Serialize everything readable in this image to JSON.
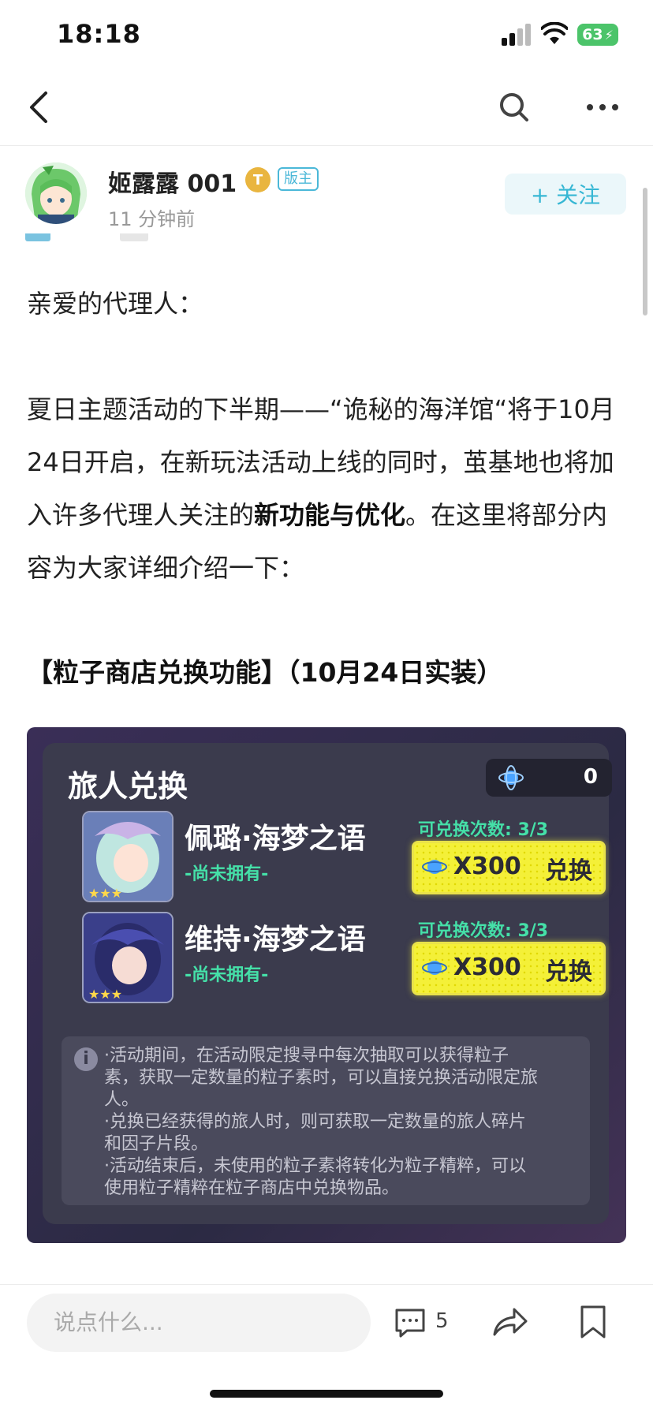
{
  "status_bar": {
    "time": "18:18",
    "battery": "63"
  },
  "author": {
    "name": "姬露露 001",
    "level_badge": "T",
    "role_badge": "版主",
    "time": "11 分钟前",
    "follow_label": "+ 关注"
  },
  "article": {
    "greeting": "亲爱的代理人：",
    "para1_pre": "夏日主题活动的下半期——“诡秘的海洋馆“将于10月24日开启，在新玩法活动上线的同时，茧基地也将加入许多代理人关注的",
    "para1_bold": "新功能与优化",
    "para1_post": "。在这里将部分内容为大家详细介绍一下：",
    "section_title": "【粒子商店兑换功能】（10月24日实装）"
  },
  "game_panel": {
    "title": "旅人兑换",
    "currency_value": "0",
    "items": [
      {
        "name": "佩璐·海梦之语",
        "status": "-尚未拥有-",
        "count_label": "可兑换次数: 3/3",
        "price": "X300",
        "button": "兑换"
      },
      {
        "name": "维持·海梦之语",
        "status": "-尚未拥有-",
        "count_label": "可兑换次数: 3/3",
        "price": "X300",
        "button": "兑换"
      }
    ],
    "notes": [
      "·活动期间，在活动限定搜寻中每次抽取可以获得粒子",
      "素，获取一定数量的粒子素时，可以直接兑换活动限定旅",
      "人。",
      "·兑换已经获得的旅人时，则可获取一定数量的旅人碎片",
      "和因子片段。",
      "·活动结束后，未使用的粒子素将转化为粒子精粹，可以",
      "使用粒子精粹在粒子商店中兑换物品。"
    ]
  },
  "bottom_bar": {
    "comment_placeholder": "说点什么...",
    "comment_count": "5"
  },
  "colors": {
    "accent": "#37b7d4",
    "exchange_yellow": "#f4f038",
    "panel_bg": "#3b3b4d",
    "green_text": "#45e0a8"
  }
}
